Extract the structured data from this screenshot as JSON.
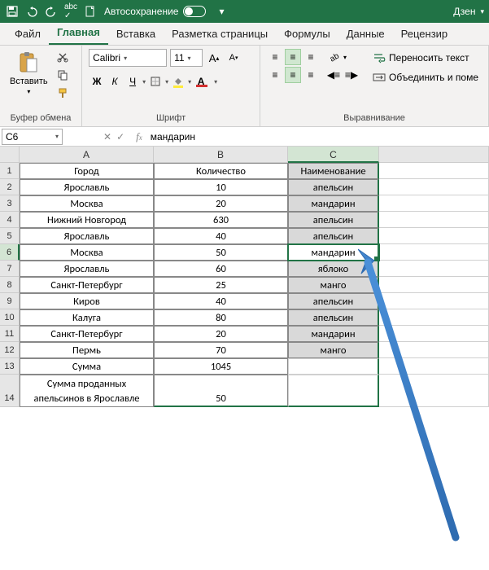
{
  "titlebar": {
    "autosave_label": "Автосохранение",
    "user": "Дзен"
  },
  "tabs": {
    "file": "Файл",
    "home": "Главная",
    "insert": "Вставка",
    "layout": "Разметка страницы",
    "formulas": "Формулы",
    "data": "Данные",
    "review": "Рецензир"
  },
  "ribbon": {
    "clipboard": {
      "paste": "Вставить",
      "label": "Буфер обмена"
    },
    "font": {
      "name": "Calibri",
      "size": "11",
      "bold": "Ж",
      "italic": "К",
      "underline": "Ч",
      "label": "Шрифт"
    },
    "align": {
      "wrap": "Переносить текст",
      "merge": "Объединить и поме",
      "label": "Выравнивание"
    }
  },
  "namebox": "C6",
  "formula": "мандарин",
  "columns": {
    "A": "A",
    "B": "B",
    "C": "C"
  },
  "headers": {
    "A": "Город",
    "B": "Количество",
    "C": "Наименование"
  },
  "rows": [
    {
      "n": "2",
      "A": "Ярославль",
      "B": "10",
      "C": "апельсин"
    },
    {
      "n": "3",
      "A": "Москва",
      "B": "20",
      "C": "мандарин"
    },
    {
      "n": "4",
      "A": "Нижний Новгород",
      "B": "630",
      "C": "апельсин"
    },
    {
      "n": "5",
      "A": "Ярославль",
      "B": "40",
      "C": "апельсин"
    },
    {
      "n": "6",
      "A": "Москва",
      "B": "50",
      "C": "мандарин"
    },
    {
      "n": "7",
      "A": "Ярославль",
      "B": "60",
      "C": "яблоко"
    },
    {
      "n": "8",
      "A": "Санкт-Петербург",
      "B": "25",
      "C": "манго"
    },
    {
      "n": "9",
      "A": "Киров",
      "B": "40",
      "C": "апельсин"
    },
    {
      "n": "10",
      "A": "Калуга",
      "B": "80",
      "C": "апельсин"
    },
    {
      "n": "11",
      "A": "Санкт-Петербург",
      "B": "20",
      "C": "мандарин"
    },
    {
      "n": "12",
      "A": "Пермь",
      "B": "70",
      "C": "манго"
    },
    {
      "n": "13",
      "A": "Сумма",
      "B": "1045",
      "C": ""
    }
  ],
  "row14": {
    "n": "14",
    "A": "Сумма проданных апельсинов в Ярославле",
    "B": "50",
    "C": ""
  }
}
